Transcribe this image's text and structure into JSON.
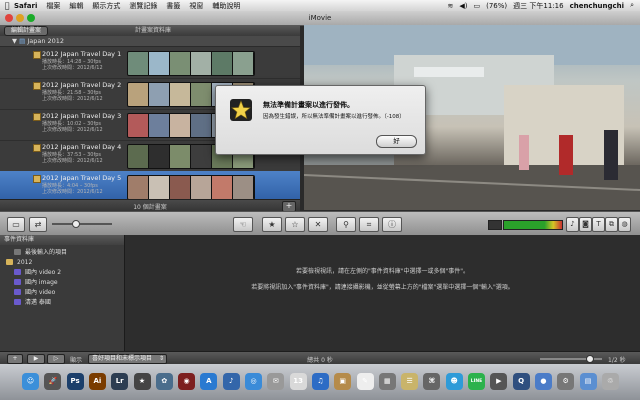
{
  "menubar": {
    "app_name": "Safari",
    "items": [
      "檔案",
      "編輯",
      "顯示方式",
      "瀏覽記錄",
      "書籤",
      "視窗",
      "輔助說明"
    ],
    "battery": "(76%)",
    "clock": "週三 下午11:16",
    "user": "chenchungchi"
  },
  "window": {
    "title": "iMovie"
  },
  "event_bar": {
    "edit_button": "編輯計畫案",
    "library_label": "計畫案資料庫"
  },
  "project_library": {
    "group": "Japan 2012",
    "projects": [
      {
        "name": "2012 Japan Travel Day 1",
        "duration": "播放時長：14:28 – 30fps",
        "updated": "上次修改時間：2012/6/12"
      },
      {
        "name": "2012 Japan Travel Day 2",
        "duration": "播放時長：21:58 – 30fps",
        "updated": "上次修改時間：2012/6/12"
      },
      {
        "name": "2012 Japan Travel Day 3",
        "duration": "播放時長：10:02 – 30fps",
        "updated": "上次修改時間：2012/6/12"
      },
      {
        "name": "2012 Japan Travel Day 4",
        "duration": "播放時長：37:53 – 30fps",
        "updated": "上次修改時間：2012/6/12"
      },
      {
        "name": "2012 Japan Travel Day 5",
        "duration": "播放時長：4:04 – 30fps",
        "updated": "上次修改時間：2012/6/12"
      }
    ],
    "selected_index": 4,
    "count_label": "10 個計畫案"
  },
  "dialog": {
    "title": "無法準備計畫案以進行發佈。",
    "message": "因為發生錯誤，所以無法準備計畫案以進行發佈。（-108）",
    "ok_button": "好"
  },
  "event_library": {
    "header": "事件資料庫",
    "items": [
      {
        "label": "最後輸入的項目",
        "level": 1
      },
      {
        "label": "2012",
        "level": 0
      },
      {
        "label": "國內 video 2",
        "level": 1
      },
      {
        "label": "國內 image",
        "level": 1
      },
      {
        "label": "國內 video",
        "level": 1
      },
      {
        "label": "清邁 泰國",
        "level": 1
      }
    ]
  },
  "event_hints": [
    "若要檢視視訊，請在左側的\"事件資料庫\"中選擇一或多個\"事件\"。",
    "若要將視訊加入\"事件資料庫\"，請連接攝影機，並從螢幕上方的\"檔案\"選單中選擇一個\"輸入\"選項。"
  ],
  "bottom_bar": {
    "show_label": "顯示",
    "filter_select": "喜好項目和未標示項目",
    "duration_label": "總共 0 秒",
    "zoom_label": "1/2 秒"
  },
  "dock_icons": [
    {
      "name": "finder-icon",
      "glyph": "☺",
      "color": "#3b8fd9"
    },
    {
      "name": "launchpad-icon",
      "glyph": "🚀",
      "color": "#555"
    },
    {
      "name": "photoshop-icon",
      "glyph": "Ps",
      "color": "#1b3f6b"
    },
    {
      "name": "illustrator-icon",
      "glyph": "Ai",
      "color": "#7a3c00"
    },
    {
      "name": "lightroom-icon",
      "glyph": "Lr",
      "color": "#2c3d52"
    },
    {
      "name": "imovie-icon",
      "glyph": "★",
      "color": "#444"
    },
    {
      "name": "iphoto-icon",
      "glyph": "✿",
      "color": "#4a6d8c"
    },
    {
      "name": "photo-booth-icon",
      "glyph": "◉",
      "color": "#7d1f1f"
    },
    {
      "name": "app-store-icon",
      "glyph": "A",
      "color": "#2a7ad1"
    },
    {
      "name": "itunes-icon",
      "glyph": "♪",
      "color": "#3366aa"
    },
    {
      "name": "safari-icon",
      "glyph": "◎",
      "color": "#3a8bd8"
    },
    {
      "name": "mail-icon",
      "glyph": "✉",
      "color": "#999"
    },
    {
      "name": "calendar-icon",
      "glyph": "13",
      "color": "#d9d9d9"
    },
    {
      "name": "music-icon",
      "glyph": "♫",
      "color": "#2d6cc5"
    },
    {
      "name": "preview-icon",
      "glyph": "▣",
      "color": "#b58b4a"
    },
    {
      "name": "textedit-icon",
      "glyph": "✎",
      "color": "#eee"
    },
    {
      "name": "calculator-icon",
      "glyph": "▦",
      "color": "#777"
    },
    {
      "name": "notes-icon",
      "glyph": "☰",
      "color": "#c9b46a"
    },
    {
      "name": "network-icon",
      "glyph": "⌘",
      "color": "#666"
    },
    {
      "name": "messenger-icon",
      "glyph": "☻",
      "color": "#2f9bd8"
    },
    {
      "name": "line-icon",
      "glyph": "LINE",
      "color": "#2bb24c"
    },
    {
      "name": "screenshot-icon",
      "glyph": "▶",
      "color": "#555"
    },
    {
      "name": "quicktime-icon",
      "glyph": "Q",
      "color": "#2f4f7f"
    },
    {
      "name": "browser-icon",
      "glyph": "●",
      "color": "#4b7cc8"
    },
    {
      "name": "settings-icon",
      "glyph": "⚙",
      "color": "#777"
    },
    {
      "name": "folder-icon",
      "glyph": "▤",
      "color": "#5b8fd1"
    },
    {
      "name": "trash-icon",
      "glyph": "♲",
      "color": "#aaa"
    }
  ]
}
